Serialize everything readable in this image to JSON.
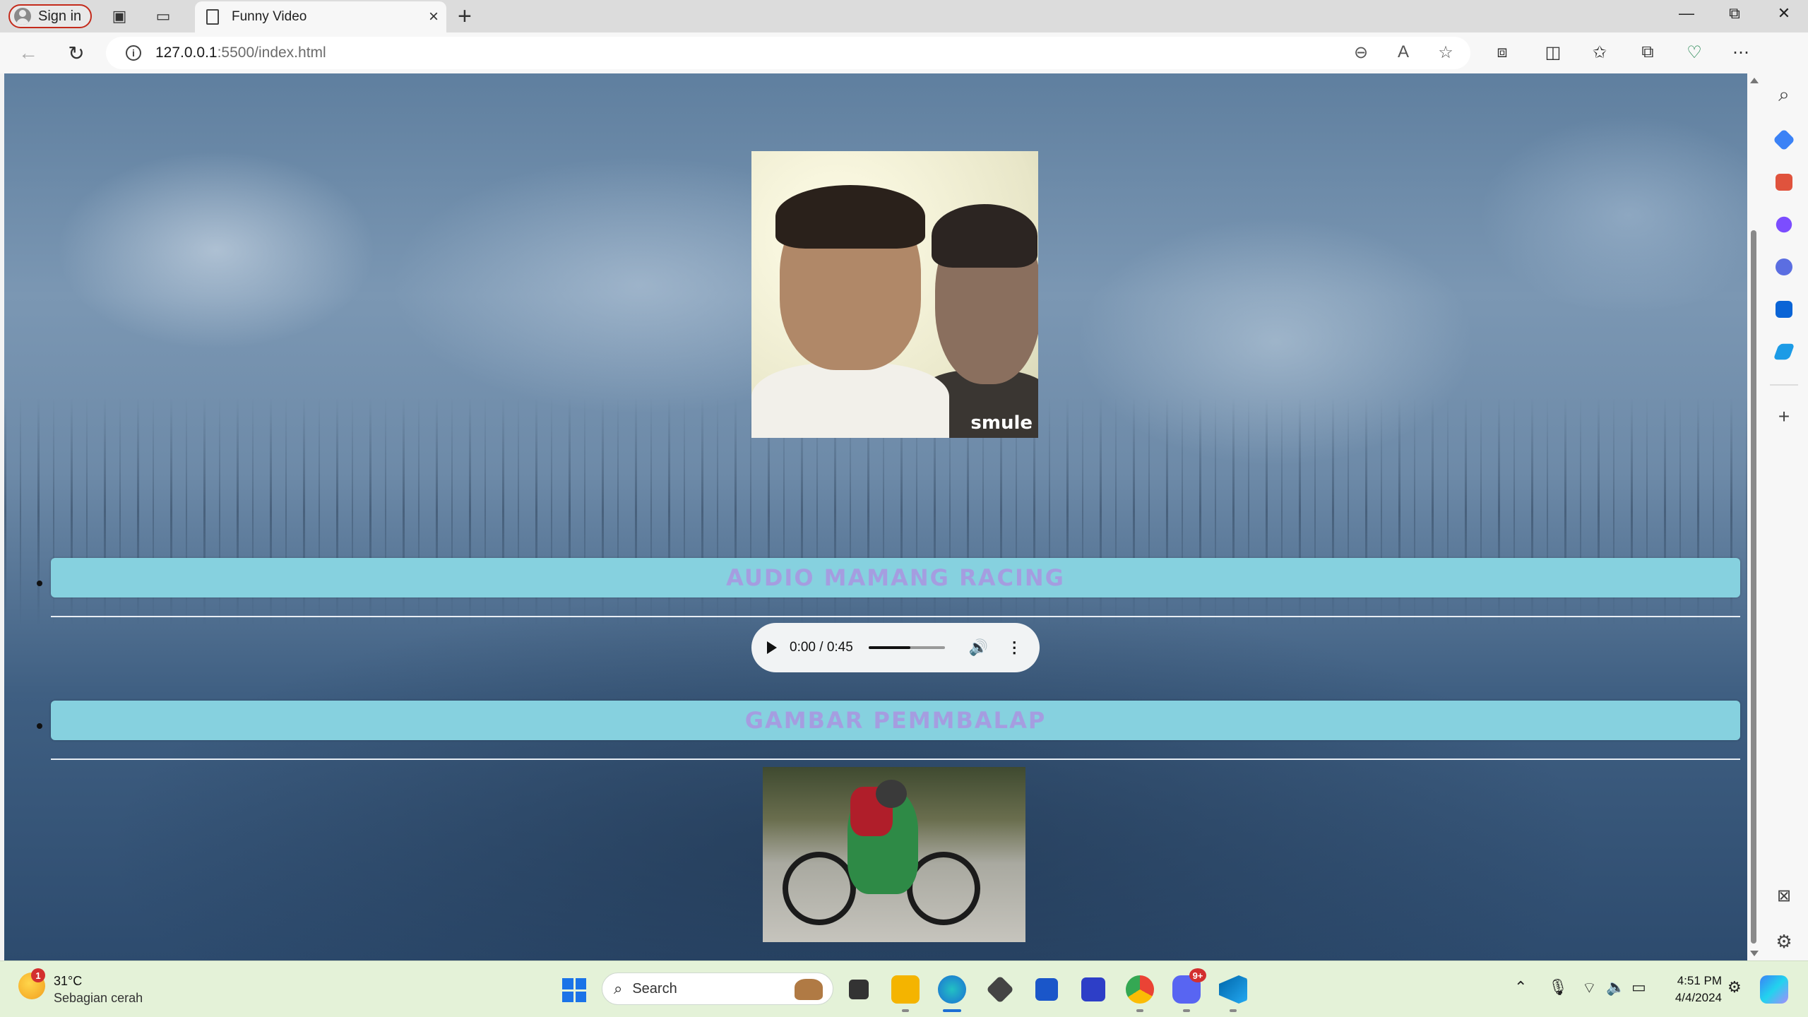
{
  "browser": {
    "sign_in_label": "Sign in",
    "tab_title": "Funny Video",
    "url_host": "127.0.0.1",
    "url_path": ":5500/index.html"
  },
  "page": {
    "video_watermark": "smule",
    "section1_title": "AUDIO MAMANG RACING",
    "audio_time": "0:00 / 0:45",
    "audio_volume_level": 0.55,
    "section2_title": "GAMBAR PEMMBALAP"
  },
  "taskbar": {
    "weather_temp": "31°C",
    "weather_desc": "Sebagian cerah",
    "weather_badge": "1",
    "search_label": "Search",
    "discord_badge": "9+",
    "time": "4:51 PM",
    "date": "4/4/2024"
  },
  "colors": {
    "section_bar": "#86d1df",
    "section_text": "#a59de0",
    "signin_border": "#c42b1c"
  },
  "icons": [
    "person-icon",
    "workspaces-icon",
    "tab-actions-icon",
    "page-icon",
    "close-icon",
    "plus-icon",
    "back-icon",
    "refresh-icon",
    "info-icon",
    "zoom-out-icon",
    "read-aloud-icon",
    "favorite-star-icon",
    "extensions-icon",
    "split-screen-icon",
    "favorites-icon",
    "collections-icon",
    "browser-essentials-icon",
    "more-icon",
    "copilot-icon"
  ]
}
